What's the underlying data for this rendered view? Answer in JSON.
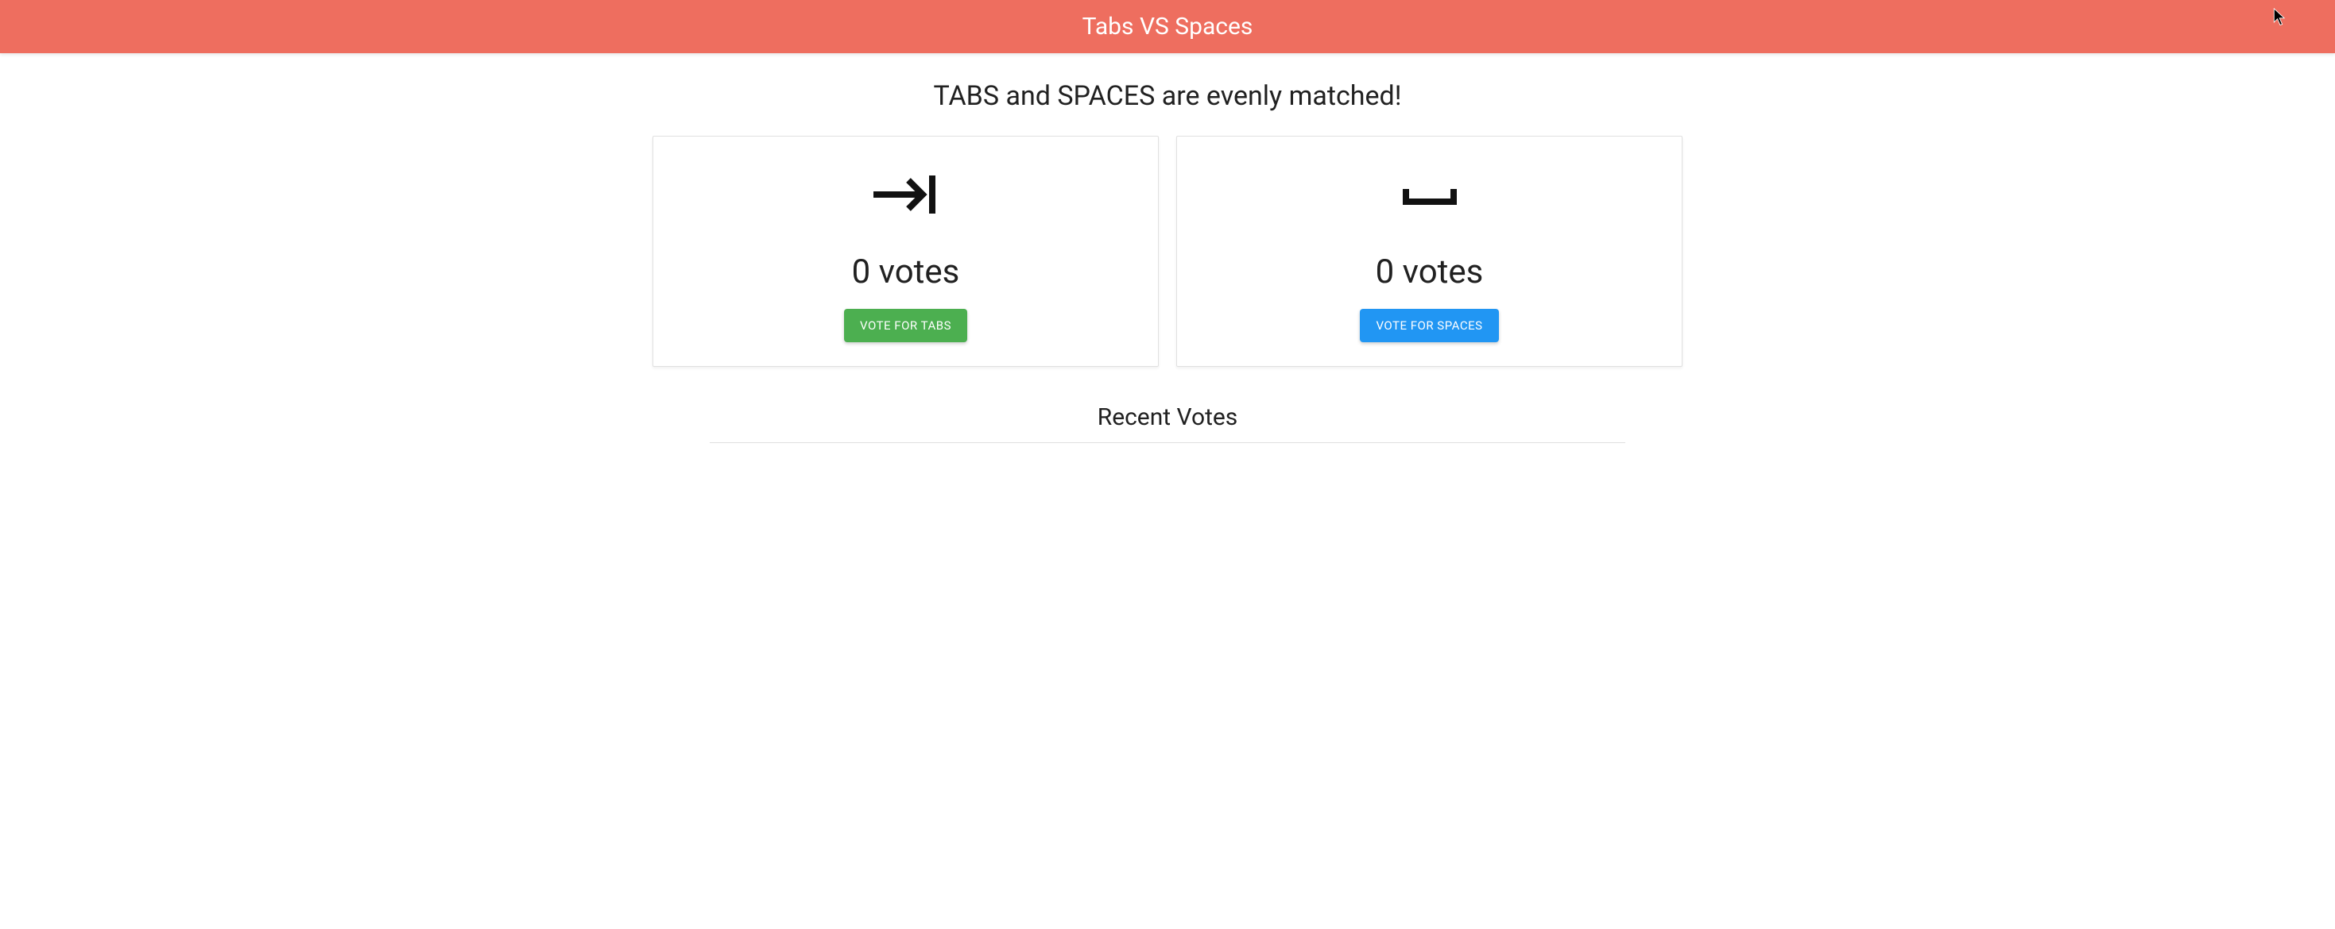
{
  "header": {
    "title": "Tabs VS Spaces"
  },
  "headline": "TABS and SPACES are evenly matched!",
  "cards": {
    "tabs": {
      "count_text": "0 votes",
      "button_label": "VOTE FOR TABS"
    },
    "spaces": {
      "count_text": "0 votes",
      "button_label": "VOTE FOR SPACES"
    }
  },
  "recent": {
    "title": "Recent Votes"
  },
  "colors": {
    "header_bg": "#ee6e5f",
    "btn_green": "#4caf50",
    "btn_blue": "#2196f3"
  }
}
